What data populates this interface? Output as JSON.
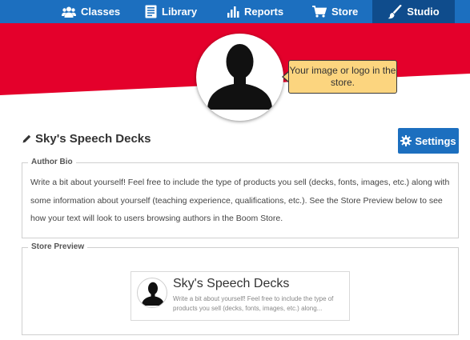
{
  "nav": {
    "classes": "Classes",
    "library": "Library",
    "reports": "Reports",
    "store": "Store",
    "studio": "Studio"
  },
  "colors": {
    "nav_bg": "#1c6fbf",
    "nav_active_bg": "#0f4c8c",
    "banner_red": "#e4002b",
    "tooltip_bg": "#fcd57f"
  },
  "tooltip": {
    "text": "Your image or logo in the store."
  },
  "store": {
    "name": "Sky's Speech Decks",
    "edit_icon": "pencil-icon"
  },
  "settings_button": {
    "label": "Settings",
    "icon": "gear-icon"
  },
  "author_bio": {
    "legend": "Author Bio",
    "text": "Write a bit about yourself! Feel free to include the type of products you sell (decks, fonts, images, etc.) along with some information about yourself (teaching experience, qualifications, etc.). See the Store Preview below to see how your text will look to users browsing authors in the Boom Store."
  },
  "store_preview": {
    "legend": "Store Preview",
    "card_name": "Sky's Speech Decks",
    "card_desc": "Write a bit about yourself! Feel free to include the type of products you sell (decks, fonts, images, etc.) along..."
  }
}
